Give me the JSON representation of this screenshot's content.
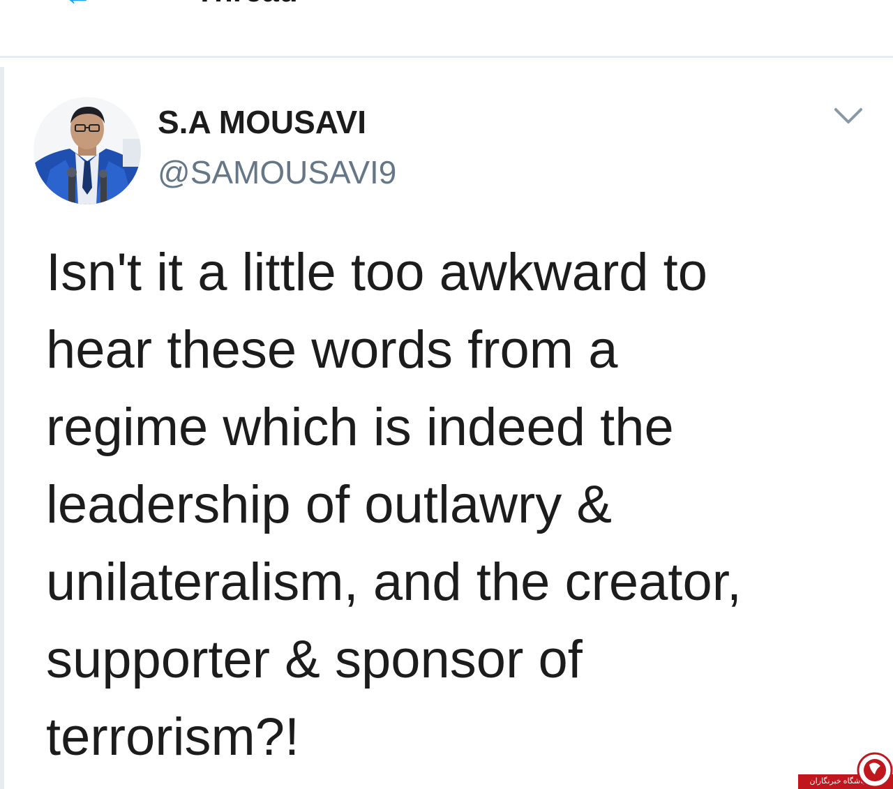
{
  "header": {
    "title": "Thread",
    "back_icon": "back-arrow-icon"
  },
  "tweet": {
    "display_name": "S.A MOUSAVI",
    "handle": "@SAMOUSAVI9",
    "menu_icon": "chevron-down-icon",
    "text_lines": [
      "Isn't it a little too awkward to",
      "hear these words from a",
      "regime which is indeed the",
      "leadership of outlawry &",
      "unilateralism, and the creator,",
      "supporter & sponsor of",
      "terrorism?!"
    ]
  },
  "watermark": {
    "label": "باشگاه خبرنگاران"
  },
  "colors": {
    "accent": "#1da1f2",
    "text": "#14171a",
    "secondary_text": "#657786",
    "divider": "#e6ecf0",
    "watermark_red": "#c0171f"
  }
}
